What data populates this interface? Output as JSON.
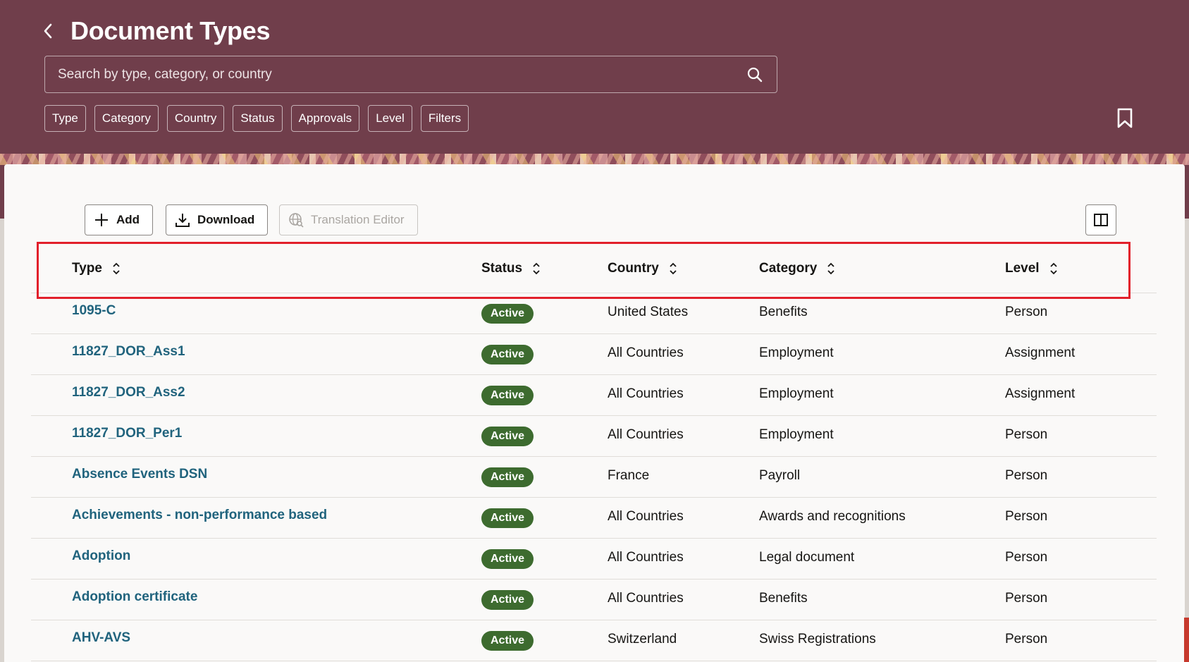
{
  "header": {
    "title": "Document Types",
    "back_icon": "chevron-left-icon",
    "search": {
      "placeholder": "Search by type, category, or country",
      "value": ""
    },
    "filter_chips": [
      "Type",
      "Category",
      "Country",
      "Status",
      "Approvals",
      "Level",
      "Filters"
    ],
    "bookmark_icon": "bookmark-icon",
    "background_color": "#703e4b"
  },
  "toolbar": {
    "add_label": "Add",
    "download_label": "Download",
    "translation_label": "Translation Editor",
    "column_toggle_icon": "columns-icon"
  },
  "table": {
    "columns": [
      {
        "label": "Type"
      },
      {
        "label": "Status"
      },
      {
        "label": "Country"
      },
      {
        "label": "Category"
      },
      {
        "label": "Level"
      }
    ],
    "rows": [
      {
        "type": "1095-C",
        "status": "Active",
        "country": "United States",
        "category": "Benefits",
        "level": "Person"
      },
      {
        "type": "11827_DOR_Ass1",
        "status": "Active",
        "country": "All Countries",
        "category": "Employment",
        "level": "Assignment"
      },
      {
        "type": "11827_DOR_Ass2",
        "status": "Active",
        "country": "All Countries",
        "category": "Employment",
        "level": "Assignment"
      },
      {
        "type": "11827_DOR_Per1",
        "status": "Active",
        "country": "All Countries",
        "category": "Employment",
        "level": "Person"
      },
      {
        "type": "Absence Events DSN",
        "status": "Active",
        "country": "France",
        "category": "Payroll",
        "level": "Person"
      },
      {
        "type": "Achievements - non-performance based",
        "status": "Active",
        "country": "All Countries",
        "category": "Awards and recognitions",
        "level": "Person"
      },
      {
        "type": "Adoption",
        "status": "Active",
        "country": "All Countries",
        "category": "Legal document",
        "level": "Person"
      },
      {
        "type": "Adoption certificate",
        "status": "Active",
        "country": "All Countries",
        "category": "Benefits",
        "level": "Person"
      },
      {
        "type": "AHV-AVS",
        "status": "Active",
        "country": "Switzerland",
        "category": "Swiss Registrations",
        "level": "Person"
      }
    ],
    "status_color": "#3d6b2f",
    "link_color": "#20637d",
    "highlight_color": "#e2202b"
  }
}
